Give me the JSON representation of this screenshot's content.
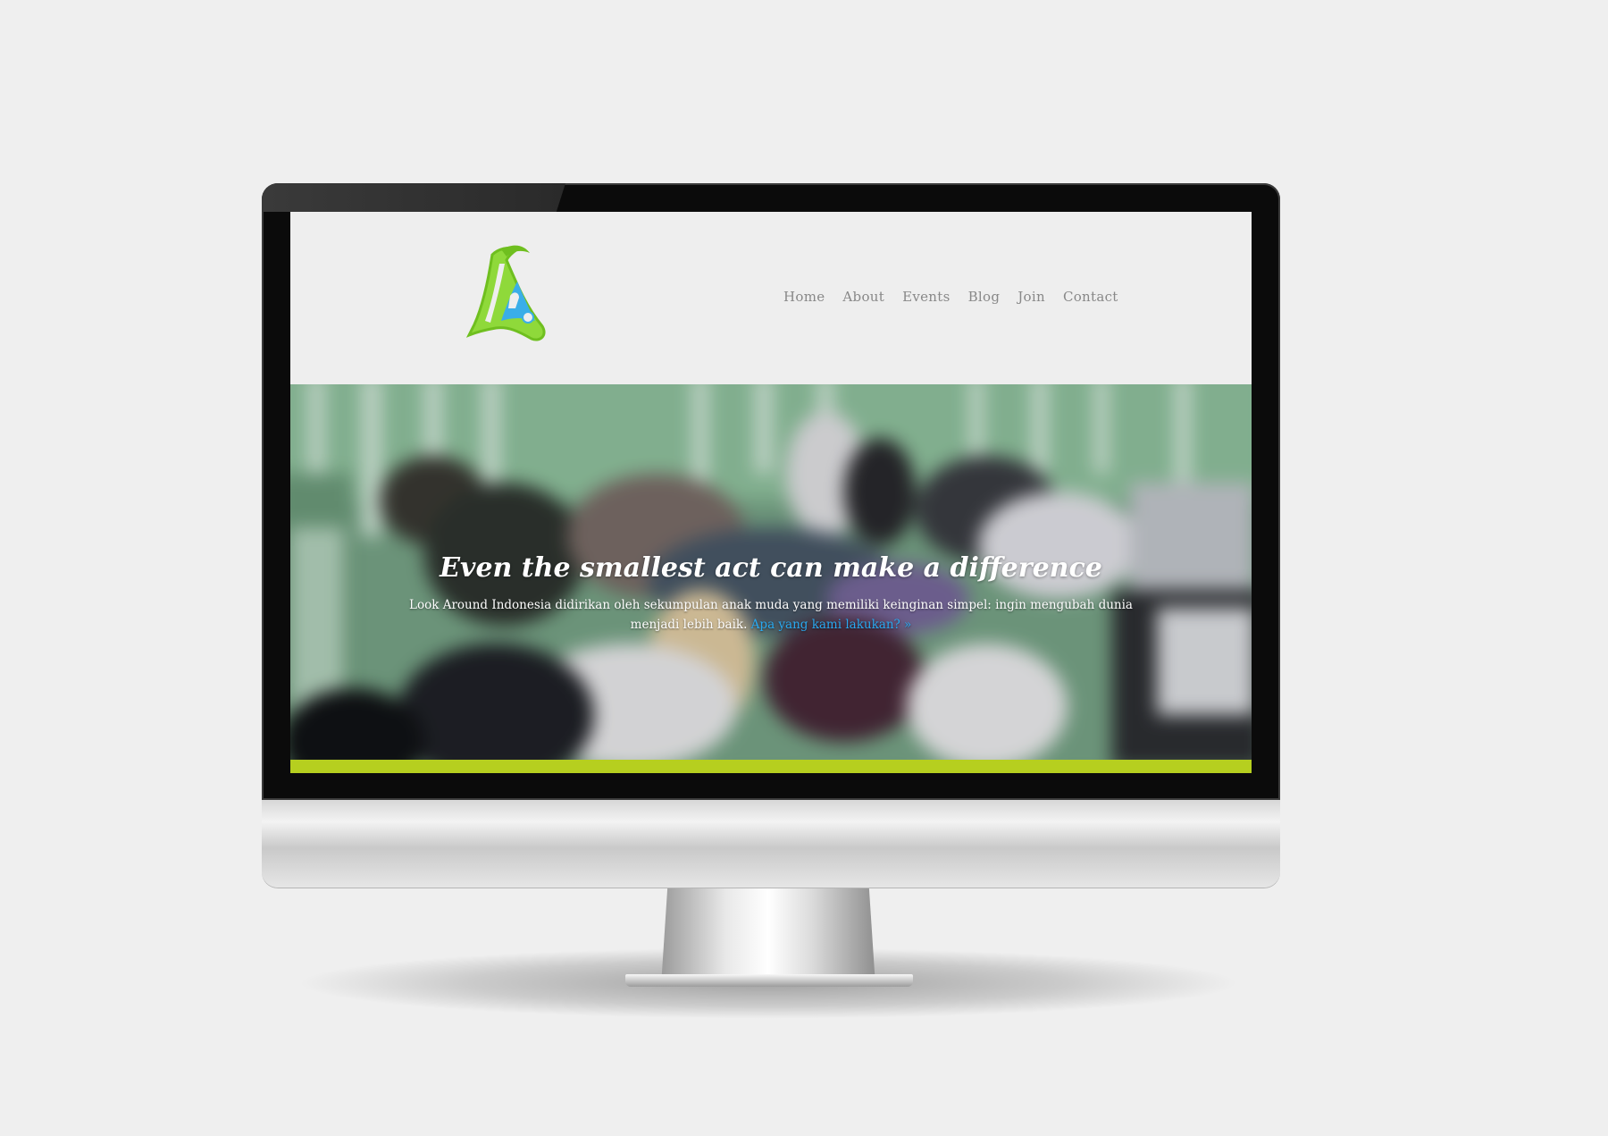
{
  "site": {
    "brand_colors": {
      "logo_green": "#7ed321",
      "logo_blue": "#3aaee8",
      "accent_bar": "#b6cf1f",
      "link_blue": "#29a9f0"
    }
  },
  "nav": {
    "items": [
      {
        "label": "Home"
      },
      {
        "label": "About"
      },
      {
        "label": "Events"
      },
      {
        "label": "Blog"
      },
      {
        "label": "Join"
      },
      {
        "label": "Contact"
      }
    ]
  },
  "hero": {
    "title": "Even the smallest act can make a difference",
    "body": "Look Around Indonesia didirikan oleh sekumpulan anak muda yang memiliki keinginan simpel: ingin mengubah dunia menjadi lebih baik.",
    "link_label": "Apa yang kami lakukan? »"
  }
}
